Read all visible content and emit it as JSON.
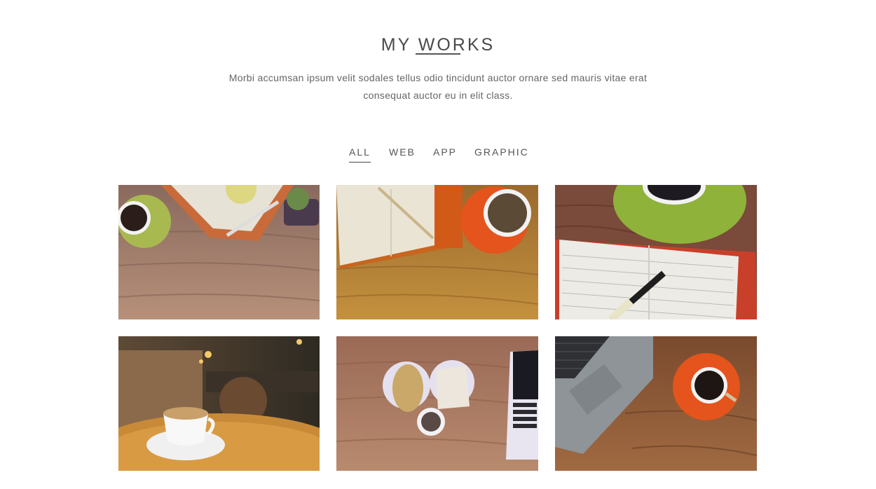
{
  "section": {
    "title": "MY WORKS",
    "description_line1": "Morbi accumsan ipsum velit sodales tellus odio tincidunt auctor ornare sed mauris vitae erat",
    "description_line2": "consequat auctor eu in elit class."
  },
  "filters": [
    {
      "label": "ALL",
      "active": true
    },
    {
      "label": "WEB",
      "active": false
    },
    {
      "label": "APP",
      "active": false
    },
    {
      "label": "GRAPHIC",
      "active": false
    }
  ],
  "portfolio_items": [
    {
      "subject": "green cup, notebook and pen on wooden desk"
    },
    {
      "subject": "notebook, pencil and orange coffee cup on wooden desk"
    },
    {
      "subject": "green saucer and notebook with fountain pen"
    },
    {
      "subject": "latte art cup on round café table"
    },
    {
      "subject": "toast, coffee mug and laptop on wooden table"
    },
    {
      "subject": "laptop and orange coffee cup on wooden desk"
    }
  ],
  "colors": {
    "text_dark": "#4a4a4a",
    "wood_light": "#b08a6a",
    "wood_warm": "#c48a3c",
    "accent_orange": "#e4541c",
    "accent_green": "#8fb23a"
  }
}
